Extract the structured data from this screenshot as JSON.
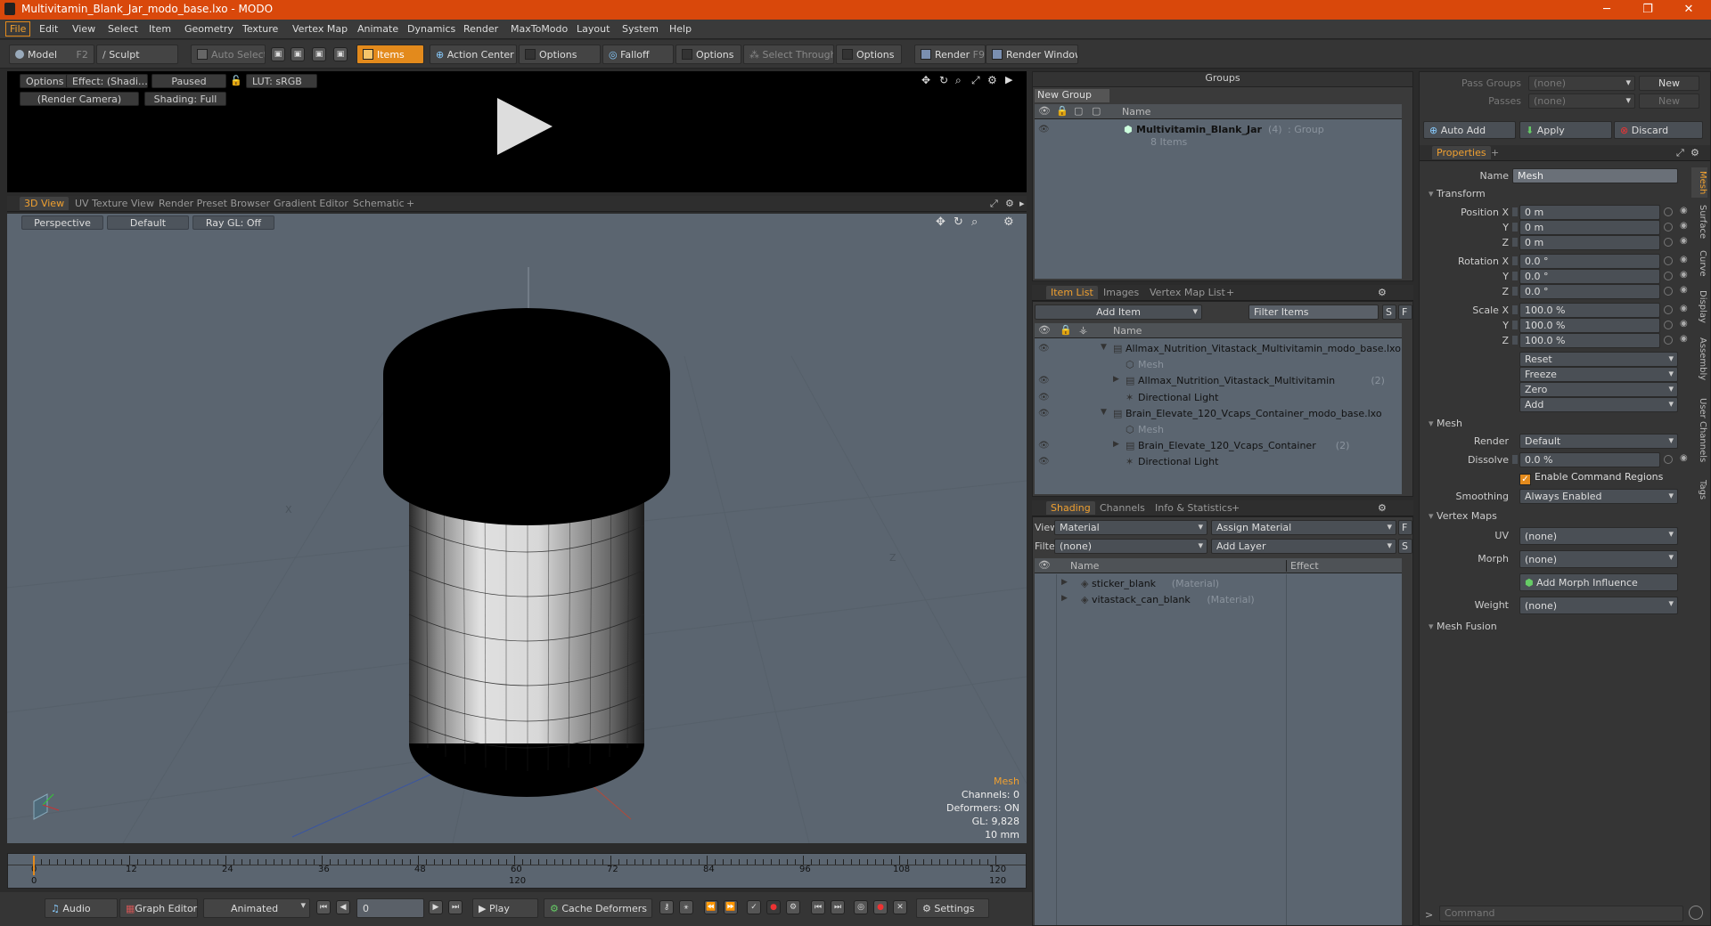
{
  "window": {
    "title": "Multivitamin_Blank_Jar_modo_base.lxo - MODO",
    "minimize": "─",
    "maximize": "❐",
    "close": "✕"
  },
  "menu": [
    "File",
    "Edit",
    "View",
    "Select",
    "Item",
    "Geometry",
    "Texture",
    "Vertex Map",
    "Animate",
    "Dynamics",
    "Render",
    "MaxToModo",
    "Layout",
    "System",
    "Help"
  ],
  "toolbar": {
    "model": "Model",
    "model_key": "F2",
    "sculpt": "Sculpt",
    "auto_select": "Auto Select",
    "items": "Items",
    "action_center": "Action Center",
    "options": "Options",
    "falloff": "Falloff",
    "select_through": "Select Through",
    "render": "Render",
    "render_key": "F9",
    "render_window": "Render Window"
  },
  "preview": {
    "options": "Options",
    "effect": "Effect: (Shadi…",
    "paused": "Paused",
    "lut": "LUT: sRGB",
    "camera": "(Render Camera)",
    "shading": "Shading: Full"
  },
  "view_tabs": [
    "3D View",
    "UV Texture View",
    "Render Preset Browser",
    "Gradient Editor",
    "Schematic",
    "+"
  ],
  "viewport": {
    "perspective": "Perspective",
    "default": "Default",
    "raygl": "Ray GL: Off",
    "axis_x": "X",
    "axis_z": "Z",
    "info": {
      "title": "Mesh",
      "channels": "Channels: 0",
      "deformers": "Deformers: ON",
      "gl": "GL: 9,828",
      "scale": "10 mm"
    }
  },
  "timeline": {
    "ticks": [
      "0",
      "12",
      "24",
      "36",
      "48",
      "60",
      "72",
      "84",
      "96",
      "108",
      "120"
    ],
    "sub": [
      "0",
      "120",
      "120"
    ]
  },
  "bottom": {
    "audio": "Audio",
    "graph_editor": "Graph Editor",
    "animated": "Animated",
    "frame": "0",
    "play": "Play",
    "cache": "Cache Deformers",
    "settings": "Settings"
  },
  "groups": {
    "title": "Groups",
    "new_group": "New Group",
    "col_name": "Name",
    "item": {
      "name": "Multivitamin_Blank_Jar",
      "count": "(4)",
      "type": ": Group",
      "sub": "8 Items"
    }
  },
  "itemlist": {
    "tabs": [
      "Item List",
      "Images",
      "Vertex Map List",
      "+"
    ],
    "add_item": "Add Item",
    "filter": "Filter Items",
    "s": "S",
    "f": "F",
    "col_name": "Name",
    "rows": [
      {
        "label": "Allmax_Nutrition_Vitastack_Multivitamin_modo_base.lxo",
        "extra": "",
        "indent": 0,
        "arrow": "▼",
        "dim": false
      },
      {
        "label": "Mesh",
        "extra": "",
        "indent": 1,
        "arrow": "",
        "dim": true
      },
      {
        "label": "Allmax_Nutrition_Vitastack_Multivitamin",
        "extra": "(2)",
        "indent": 1,
        "arrow": "▶",
        "dim": false
      },
      {
        "label": "Directional Light",
        "extra": "",
        "indent": 1,
        "arrow": "",
        "dim": false
      },
      {
        "label": "Brain_Elevate_120_Vcaps_Container_modo_base.lxo",
        "extra": "",
        "indent": 0,
        "arrow": "▼",
        "dim": false
      },
      {
        "label": "Mesh",
        "extra": "",
        "indent": 1,
        "arrow": "",
        "dim": true
      },
      {
        "label": "Brain_Elevate_120_Vcaps_Container",
        "extra": "(2)",
        "indent": 1,
        "arrow": "▶",
        "dim": false
      },
      {
        "label": "Directional Light",
        "extra": "",
        "indent": 1,
        "arrow": "",
        "dim": false
      }
    ]
  },
  "shading": {
    "tabs": [
      "Shading",
      "Channels",
      "Info & Statistics",
      "+"
    ],
    "view_lbl": "View",
    "view_val": "Material",
    "assign": "Assign Material",
    "f": "F",
    "filter_lbl": "Filter",
    "filter_val": "(none)",
    "add_layer": "Add Layer",
    "s": "S",
    "col_name": "Name",
    "col_effect": "Effect",
    "rows": [
      {
        "label": "sticker_blank",
        "type": "(Material)"
      },
      {
        "label": "vitastack_can_blank",
        "type": "(Material)"
      }
    ]
  },
  "props": {
    "pass_groups": "Pass Groups",
    "passes": "Passes",
    "none": "(none)",
    "new": "New",
    "auto_add": "Auto Add",
    "apply": "Apply",
    "discard": "Discard",
    "tab": "Properties",
    "plus": "+",
    "name_lbl": "Name",
    "name_val": "Mesh",
    "transform": "Transform",
    "pos_x": "Position X",
    "y": "Y",
    "z": "Z",
    "rot_x": "Rotation X",
    "scale_x": "Scale X",
    "pos": [
      "0 m",
      "0 m",
      "0 m"
    ],
    "rot": [
      "0.0 °",
      "0.0 °",
      "0.0 °"
    ],
    "scl": [
      "100.0 %",
      "100.0 %",
      "100.0 %"
    ],
    "reset": "Reset",
    "freeze": "Freeze",
    "zero": "Zero",
    "add": "Add",
    "mesh": "Mesh",
    "render_lbl": "Render",
    "render_val": "Default",
    "dissolve_lbl": "Dissolve",
    "dissolve_val": "0.0 %",
    "enable_cmd": "Enable Command Regions",
    "smoothing_lbl": "Smoothing",
    "smoothing_val": "Always Enabled",
    "vertex_maps": "Vertex Maps",
    "uv_lbl": "UV",
    "morph_lbl": "Morph",
    "add_morph": "Add Morph Influence",
    "weight_lbl": "Weight",
    "mesh_fusion": "Mesh Fusion",
    "vtabs": [
      "Mesh",
      "Surface",
      "Curve",
      "Display",
      "Assembly",
      "User Channels",
      "Tags"
    ],
    "command": "Command"
  }
}
